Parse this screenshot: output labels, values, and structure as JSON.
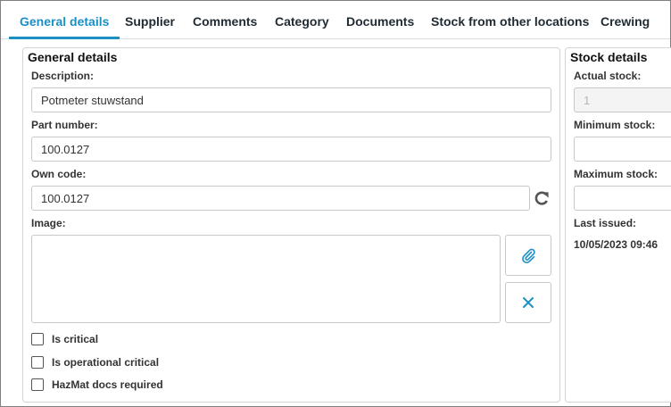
{
  "tabs": [
    {
      "label": "General details",
      "active": true
    },
    {
      "label": "Supplier"
    },
    {
      "label": "Comments"
    },
    {
      "label": "Category"
    },
    {
      "label": "Documents"
    },
    {
      "label": "Stock from other locations"
    },
    {
      "label": "Crewing"
    }
  ],
  "general": {
    "title": "General details",
    "description_label": "Description:",
    "description_value": "Potmeter stuwstand",
    "part_number_label": "Part number:",
    "part_number_value": "100.0127",
    "own_code_label": "Own code:",
    "own_code_value": "100.0127",
    "image_label": "Image:",
    "checkboxes": [
      {
        "label": "Is critical",
        "checked": false
      },
      {
        "label": "Is operational critical",
        "checked": false
      },
      {
        "label": "HazMat docs required",
        "checked": false
      }
    ]
  },
  "stock": {
    "title": "Stock details",
    "actual_label": "Actual stock:",
    "actual_value": "1",
    "minimum_label": "Minimum stock:",
    "minimum_value": "",
    "maximum_label": "Maximum stock:",
    "maximum_value": "",
    "last_issued_label": "Last issued:",
    "last_issued_value": "10/05/2023 09:46"
  },
  "icons": {
    "refresh": "refresh-icon",
    "attach": "paperclip-icon",
    "remove": "close-icon"
  },
  "colors": {
    "accent": "#1c8fc4",
    "icon_gray": "#555555",
    "border": "#c8c8c8"
  }
}
